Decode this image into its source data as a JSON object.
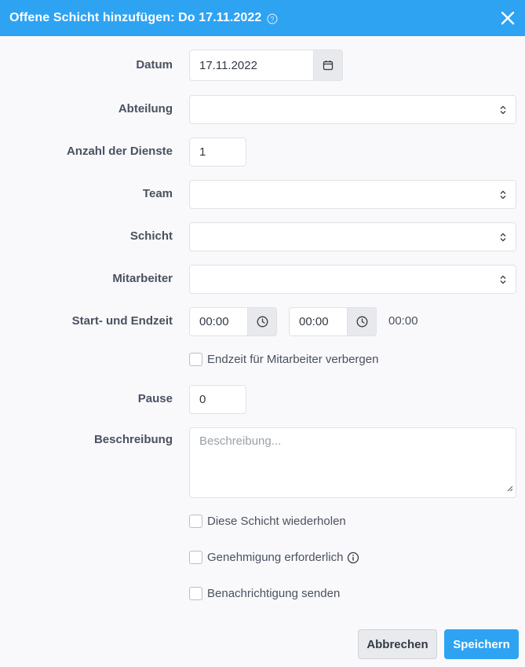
{
  "header": {
    "title": "Offene Schicht hinzufügen: Do 17.11.2022",
    "help_icon": "question-circle-icon",
    "close_icon": "close-icon"
  },
  "form": {
    "date": {
      "label": "Datum",
      "value": "17.11.2022",
      "icon": "calendar-icon"
    },
    "department": {
      "label": "Abteilung",
      "value": ""
    },
    "service_count": {
      "label": "Anzahl der Dienste",
      "value": "1"
    },
    "team": {
      "label": "Team",
      "value": ""
    },
    "shift": {
      "label": "Schicht",
      "value": ""
    },
    "employee": {
      "label": "Mitarbeiter",
      "value": ""
    },
    "time": {
      "label": "Start- und Endzeit",
      "start": "00:00",
      "end": "00:00",
      "duration": "00:00",
      "icon": "clock-icon"
    },
    "hide_endtime": {
      "label": "Endzeit für Mitarbeiter verbergen",
      "checked": false
    },
    "pause": {
      "label": "Pause",
      "value": "0"
    },
    "description": {
      "label": "Beschreibung",
      "placeholder": "Beschreibung..."
    },
    "repeat": {
      "label": "Diese Schicht wiederholen",
      "checked": false
    },
    "approval": {
      "label": "Genehmigung erforderlich",
      "checked": false,
      "icon": "info-icon"
    },
    "notify": {
      "label": "Benachrichtigung senden",
      "checked": false
    }
  },
  "buttons": {
    "cancel": "Abbrechen",
    "save": "Speichern"
  },
  "colors": {
    "accent": "#2ea3f2",
    "background": "#f9f9fb"
  }
}
